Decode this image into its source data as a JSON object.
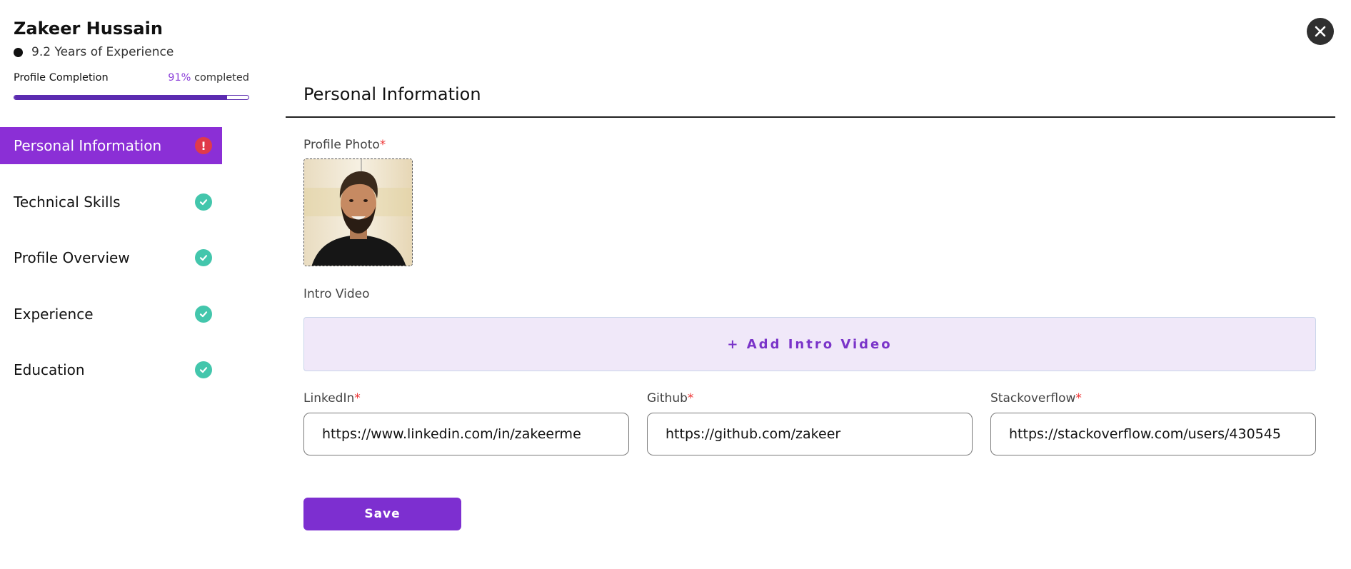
{
  "profile": {
    "name": "Zakeer Hussain",
    "experience": "9.2 Years of Experience",
    "completion_label": "Profile Completion",
    "completion_percent_text": "91%",
    "completion_suffix": "completed",
    "completion_fraction": 0.91
  },
  "nav": {
    "items": [
      {
        "label": "Personal Information",
        "status": "incomplete",
        "status_icon": "alert-icon",
        "active": true
      },
      {
        "label": "Technical Skills",
        "status": "complete",
        "status_icon": "check-circle-icon",
        "active": false
      },
      {
        "label": "Profile Overview",
        "status": "complete",
        "status_icon": "check-circle-icon",
        "active": false
      },
      {
        "label": "Experience",
        "status": "complete",
        "status_icon": "check-circle-icon",
        "active": false
      },
      {
        "label": "Education",
        "status": "complete",
        "status_icon": "check-circle-icon",
        "active": false
      }
    ]
  },
  "main": {
    "title": "Personal Information",
    "profile_photo_label": "Profile Photo",
    "intro_video_label": "Intro Video",
    "add_intro_video_label": "+ Add Intro Video",
    "linkedin": {
      "label": "LinkedIn",
      "value": "https://www.linkedin.com/in/zakeerme"
    },
    "github": {
      "label": "Github",
      "value": "https://github.com/zakeer"
    },
    "stackoverflow": {
      "label": "Stackoverflow",
      "value": "https://stackoverflow.com/users/430545"
    },
    "required_marker": "*",
    "save_label": "Save"
  },
  "icons": {
    "close": "close-icon",
    "check": "check-circle-icon",
    "alert": "alert-icon"
  },
  "colors": {
    "accent": "#8b2fd6",
    "progress": "#5b2bb0",
    "success": "#43c6ac",
    "error": "#e03a4a",
    "required": "#e33333"
  }
}
